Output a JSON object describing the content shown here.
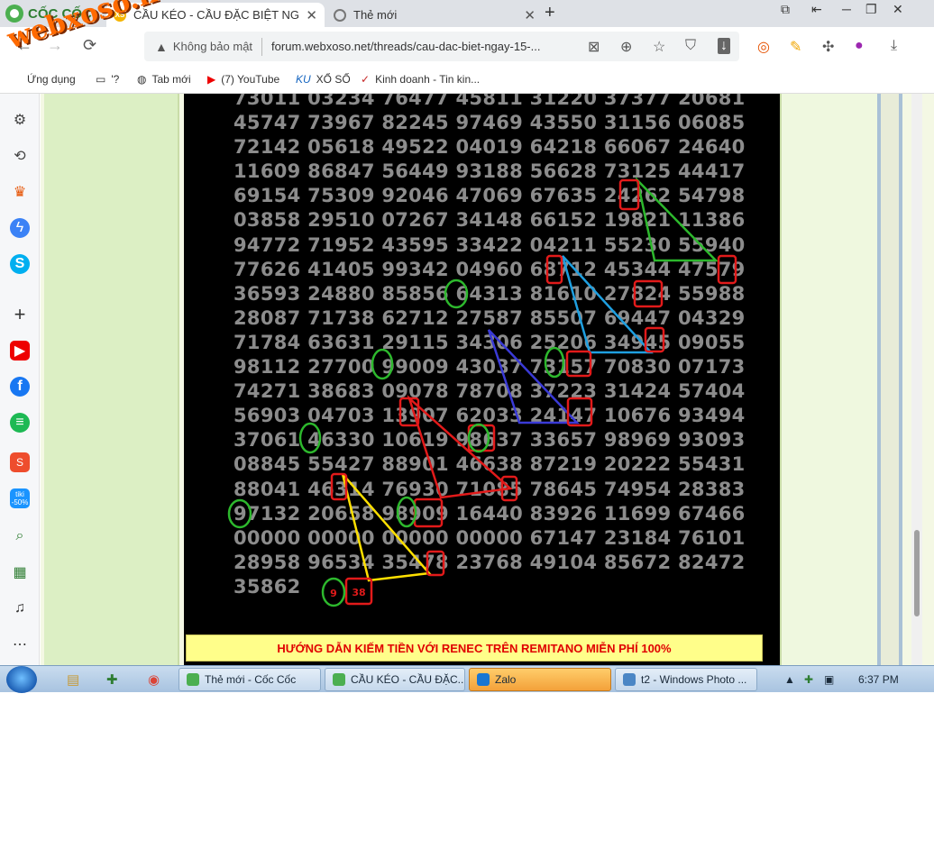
{
  "browser": {
    "brand": "CỐC CỐC",
    "tabs": [
      {
        "title": "CẦU KÉO - CẦU ĐẶC BIỆT NG",
        "favicon": "XS",
        "color": "#f5b400"
      },
      {
        "title": "Thẻ mới",
        "favicon": "coccoc-icon",
        "color": "#777777"
      }
    ],
    "new_tab": "+",
    "security_label": "Không bảo mật",
    "url": "forum.webxoso.net/threads/cau-dac-biet-ngay-15-...",
    "bookmarks": [
      {
        "label": "Ứng dụng",
        "icon": "apps-icon"
      },
      {
        "label": "'?",
        "icon": "folder-icon"
      },
      {
        "label": "Tab mới",
        "icon": "globe-icon"
      },
      {
        "label": "(7) YouTube",
        "icon": "youtube-icon"
      },
      {
        "label": "XỔ SỐ",
        "icon": "ku-icon"
      },
      {
        "label": "Kinh doanh - Tin kin...",
        "icon": "check-icon"
      }
    ],
    "watermark": "webxoso.net"
  },
  "sidebar": {
    "tiki_badge": "-50%",
    "icons": [
      "gear-icon",
      "history-icon",
      "crown-icon",
      "messenger-icon",
      "skype-icon",
      "add-icon",
      "youtube-icon",
      "facebook-icon",
      "spotify-icon",
      "shopee-icon",
      "tiki-icon",
      "lens-icon",
      "table-icon",
      "bell-icon",
      "more-icon"
    ]
  },
  "board": {
    "rows": [
      "73011 03234 76477 45811 31220 37377 20681",
      "45747 73967 82245 97469 43550 31156 06085",
      "72142 05618 49522 04019 64218 66067 24640",
      "11609 86847 56449 93188 56628 73125 44417",
      "69154 75309 92046 47069 67635 24262 54798",
      "03858 29510 07267 34148 66152 19821 11386",
      "94772 71952 43595 33422 04211 55230 55940",
      "77626 41405 99342 04960 68712 45344 47579",
      "36593 24880 85856 64313 81610 27824 55988",
      "28087 71738 62712 27587 85507 69447 04329",
      "71784 63631 29115 34306 25206 34945 09055",
      "98112 27700 99009 43037 73157 70830 07173",
      "74271 38683 09078 78708 37223 31424 57404",
      "56903 04703 13907 62033 24147 10676 93494",
      "37061 46330 10619 98637 33657 98969 93093",
      "08845 55427 88901 46638 87219 20222 55431",
      "88041 46314 76930 71085 78645 74954 28383",
      "97132 20658 98909 16440 83926 11699 67466",
      "00000 00000 00000 00000 67147 23184 76101",
      "28958 96534 35478 23768 49104 85672 82472",
      "35862"
    ],
    "circle_labels": {
      "nine": "9",
      "thirtyeight": "38"
    },
    "banner": "HƯỚNG DẪN KIẾM TIỀN VỚI RENEC TRÊN REMITANO MIỄN PHÍ 100%"
  },
  "taskbar": {
    "tasks": [
      {
        "label": "Thẻ mới - Cốc Cốc",
        "icon_color": "#4caf50",
        "highlight": false
      },
      {
        "label": "CẦU KÉO - CẦU ĐẶC...",
        "icon_color": "#4caf50",
        "highlight": false
      },
      {
        "label": "Zalo",
        "icon_color": "#1976d2",
        "highlight": true
      },
      {
        "label": "t2 - Windows Photo ...",
        "icon_color": "#4a86c5",
        "highlight": false
      }
    ],
    "clock": "6:37 PM"
  }
}
